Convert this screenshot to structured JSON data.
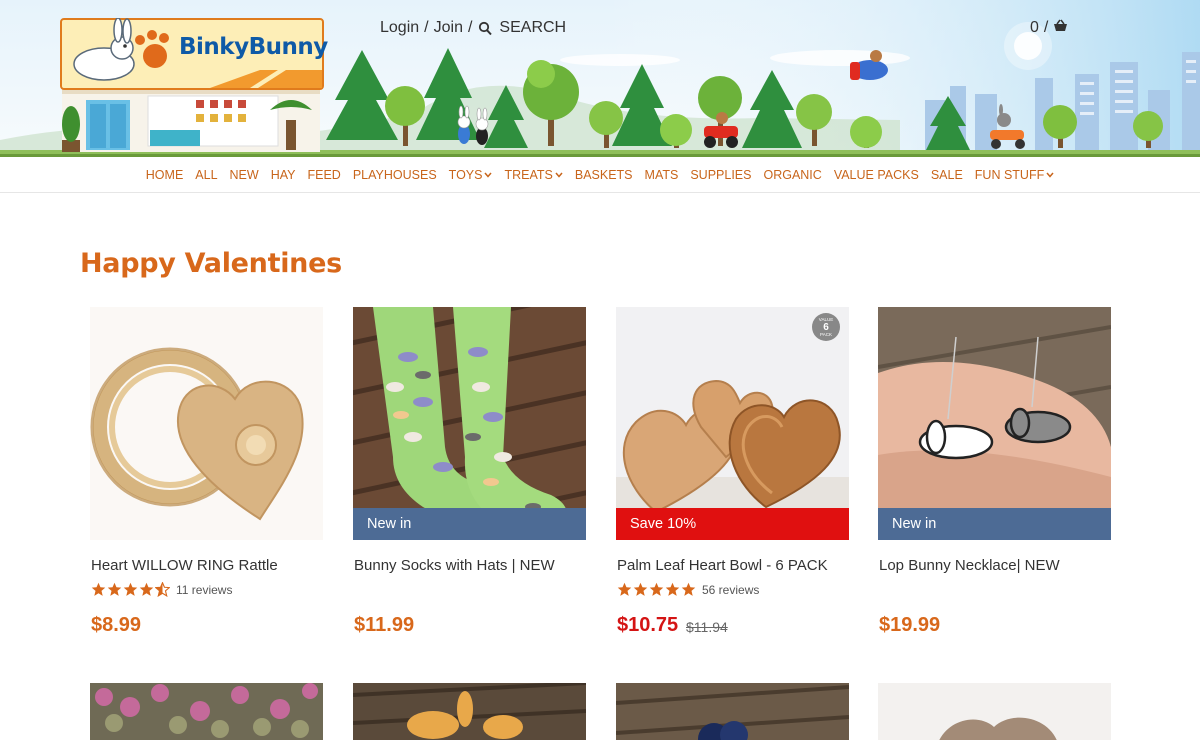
{
  "header": {
    "brand": "BinkyBunny",
    "login_label": "Login",
    "join_label": "Join",
    "search_label": "SEARCH",
    "cart_count": "0",
    "separator": "/"
  },
  "nav": {
    "items": [
      {
        "label": "HOME"
      },
      {
        "label": "ALL"
      },
      {
        "label": "NEW"
      },
      {
        "label": "HAY"
      },
      {
        "label": "FEED"
      },
      {
        "label": "PLAYHOUSES"
      },
      {
        "label": "TOYS"
      },
      {
        "label": "TREATS"
      },
      {
        "label": "BASKETS"
      },
      {
        "label": "MATS"
      },
      {
        "label": "SUPPLIES"
      },
      {
        "label": "ORGANIC"
      },
      {
        "label": "VALUE PACKS"
      },
      {
        "label": "SALE"
      },
      {
        "label": "FUN STUFF"
      }
    ]
  },
  "section": {
    "title": "Happy Valentines"
  },
  "products": [
    {
      "name": "Heart WILLOW RING Rattle",
      "rating": 4.5,
      "reviews": "11 reviews",
      "price": "$8.99",
      "old_price": "",
      "badge": ""
    },
    {
      "name": "Bunny Socks with Hats | NEW",
      "rating": 0,
      "reviews": "",
      "price": "$11.99",
      "old_price": "",
      "badge": "New in"
    },
    {
      "name": "Palm Leaf Heart Bowl - 6 PACK",
      "rating": 5,
      "reviews": "56 reviews",
      "price": "$10.75",
      "old_price": "$11.94",
      "badge": "Save 10%",
      "corner_tag_top": "VALUE",
      "corner_tag_num": "6",
      "corner_tag_bottom": "PACK"
    },
    {
      "name": "Lop Bunny Necklace| NEW",
      "rating": 0,
      "reviews": "",
      "price": "$19.99",
      "old_price": "",
      "badge": "New in"
    }
  ],
  "colors": {
    "accent": "#d8681b",
    "badge_new": "#4d6b95",
    "badge_sale": "#e01010",
    "star": "#d8681b"
  }
}
